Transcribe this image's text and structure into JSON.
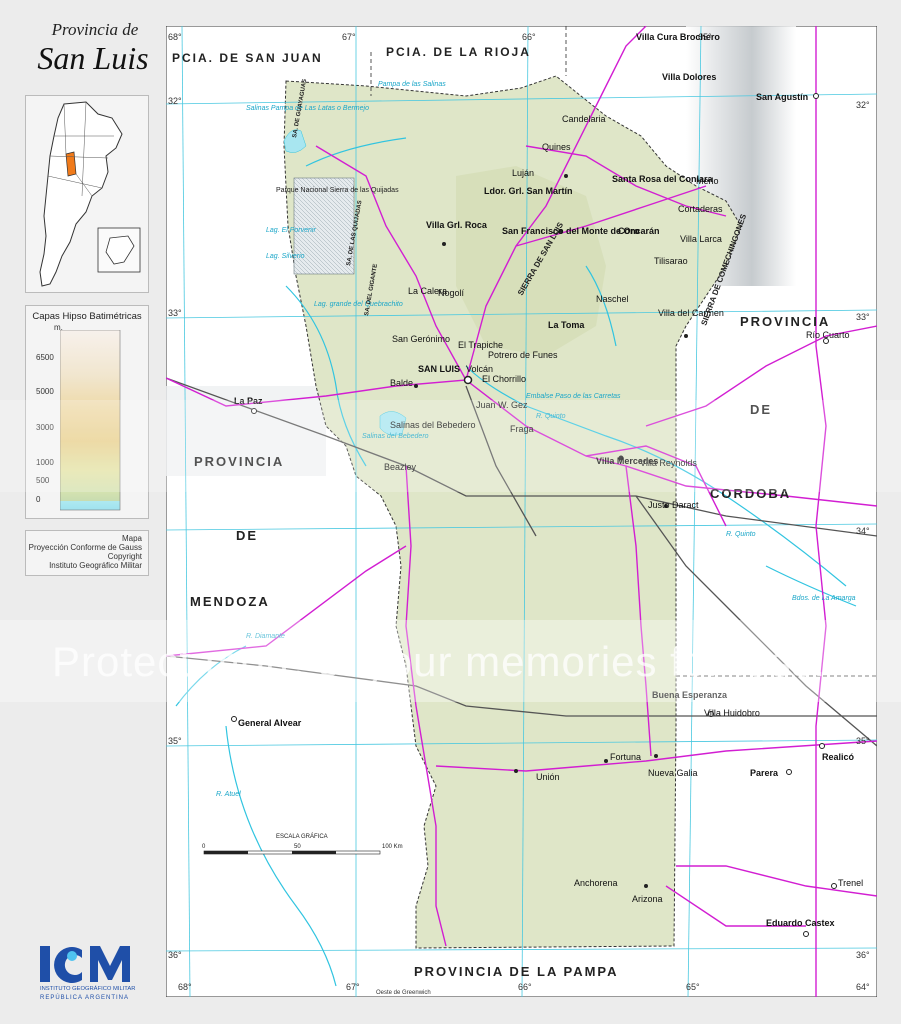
{
  "title": {
    "line1": "Provincia de",
    "line2": "San Luis"
  },
  "legend": {
    "title": "Capas Hipso Batimétricas",
    "unit": "m.",
    "levels": [
      "6500",
      "5000",
      "3000",
      "1000",
      "500",
      "0"
    ]
  },
  "credits": [
    "Mapa",
    "Proyección Conforme de Gauss",
    "Copyright",
    "Instituto Geográfico Militar"
  ],
  "logo": {
    "letters": "IGM",
    "line1": "INSTITUTO GEOGRÁFICO MILITAR",
    "line2": "REPÚBLICA ARGENTINA"
  },
  "watermark": "Protect more of your memories for less!",
  "colors": {
    "land": "#dfe6c8",
    "outside": "#ffffff",
    "roads": "#d21ed2",
    "water": "#31c4e0",
    "grid": "#49c8e0",
    "rail": "#555555"
  },
  "regions": [
    {
      "name": "PCIA. DE SAN JUAN"
    },
    {
      "name": "PCIA. DE LA RIOJA"
    },
    {
      "name": "PROVINCIA"
    },
    {
      "name": "DE"
    },
    {
      "name": "MENDOZA"
    },
    {
      "name": "PROVINCIA"
    },
    {
      "name": "DE"
    },
    {
      "name": "CORDOBA"
    },
    {
      "name": "PROVINCIA DE LA PAMPA"
    }
  ],
  "grid_labels": [
    "68°",
    "67°",
    "66°",
    "65°",
    "32°",
    "32°",
    "33°",
    "33°",
    "34°",
    "35°",
    "35°",
    "36°",
    "36°",
    "68°",
    "67°",
    "66°",
    "65°",
    "64°",
    "Oeste de Greenwich"
  ],
  "scale": {
    "title": "ESCALA GRÁFICA",
    "ticks": [
      "0",
      "50",
      "100 Km"
    ]
  },
  "places": [
    {
      "name": "Villa Cura Brochero"
    },
    {
      "name": "Villa Dolores"
    },
    {
      "name": "San Agustín"
    },
    {
      "name": "Candelaria"
    },
    {
      "name": "Quines"
    },
    {
      "name": "Luján"
    },
    {
      "name": "Ldor. Grl. San Martín"
    },
    {
      "name": "Santa Rosa del Conlara"
    },
    {
      "name": "Merlo"
    },
    {
      "name": "Cortaderas"
    },
    {
      "name": "Villa Grl. Roca"
    },
    {
      "name": "San Francisco del Monte de Oro"
    },
    {
      "name": "Concarán"
    },
    {
      "name": "Villa Larca"
    },
    {
      "name": "Tilisarao"
    },
    {
      "name": "Naschel"
    },
    {
      "name": "Nogolí"
    },
    {
      "name": "La Toma"
    },
    {
      "name": "Villa del Carmen"
    },
    {
      "name": "La Calera"
    },
    {
      "name": "San Gerónimo"
    },
    {
      "name": "El Trapiche"
    },
    {
      "name": "Potrero de Funes"
    },
    {
      "name": "SAN LUIS"
    },
    {
      "name": "Volcán"
    },
    {
      "name": "El Chorrillo"
    },
    {
      "name": "Río Cuarto"
    },
    {
      "name": "Balde"
    },
    {
      "name": "La Paz"
    },
    {
      "name": "Juan W. Gez"
    },
    {
      "name": "Salinas del Bebedero"
    },
    {
      "name": "Fraga"
    },
    {
      "name": "Villa Mercedes"
    },
    {
      "name": "Villa Reynolds"
    },
    {
      "name": "Beazley"
    },
    {
      "name": "Justo Daract"
    },
    {
      "name": "Buena Esperanza"
    },
    {
      "name": "Villa Huidobro"
    },
    {
      "name": "General Alvear"
    },
    {
      "name": "Fortuna"
    },
    {
      "name": "Unión"
    },
    {
      "name": "Nueva Galia"
    },
    {
      "name": "Parera"
    },
    {
      "name": "Realicó"
    },
    {
      "name": "Anchorena"
    },
    {
      "name": "Arizona"
    },
    {
      "name": "Trenel"
    },
    {
      "name": "Eduardo Castex"
    }
  ],
  "water_labels": [
    "Salinas Pampa de Las Latas o Bermejo",
    "Pampa de las Salinas",
    "Lag. El Porvenir",
    "Lag. Silverio",
    "Lag. grande del Quebrachito",
    "Salinas del Bebedero",
    "Embalse Paso de las Carretas",
    "R. Quinto",
    "R. Quinto",
    "R. Diamante",
    "R. Atuel",
    "Bdos. de La Amarga"
  ],
  "park": "Parque Nacional Sierra de las Quijadas",
  "ranges": [
    "SIERRA DE SAN LUIS",
    "SIERRA DE COMECHINGONES",
    "SA. DE GUAYAGUAS",
    "SA. DE LAS QUIJADAS",
    "SA. DEL GIGANTE"
  ]
}
